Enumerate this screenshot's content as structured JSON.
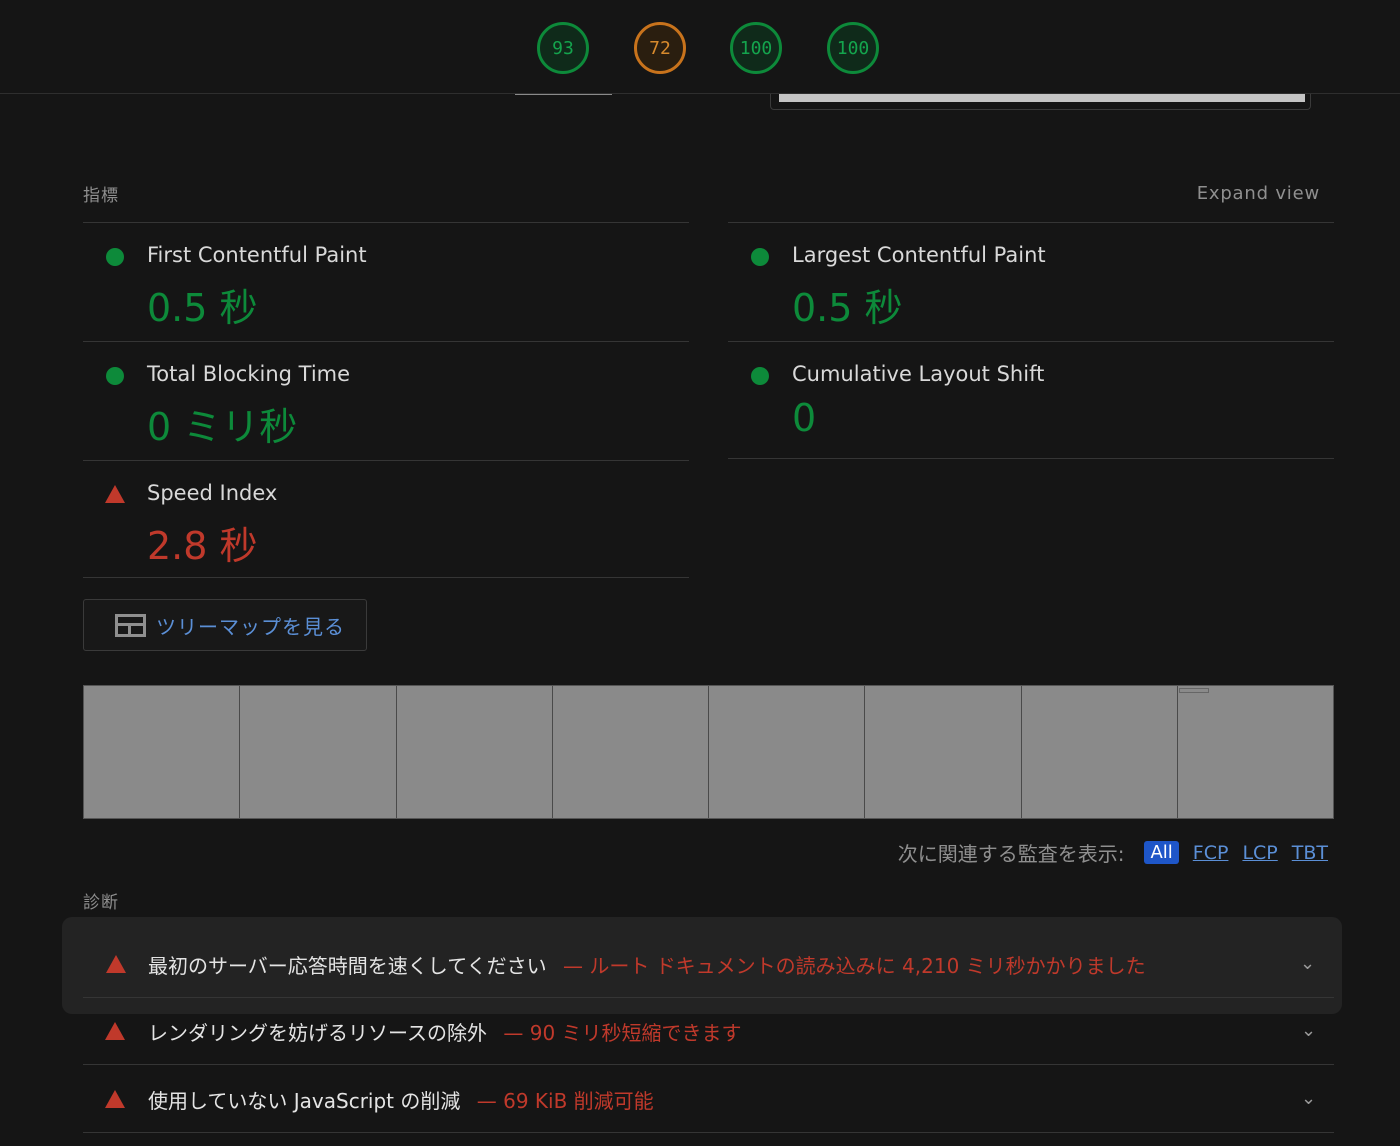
{
  "scores": [
    {
      "value": "93",
      "status": "pass"
    },
    {
      "value": "72",
      "status": "average"
    },
    {
      "value": "100",
      "status": "pass"
    },
    {
      "value": "100",
      "status": "pass"
    }
  ],
  "metrics_section": {
    "label": "指標",
    "expand_label": "Expand view",
    "items": [
      {
        "name": "First Contentful Paint",
        "value": "0.5 秒",
        "status": "good"
      },
      {
        "name": "Largest Contentful Paint",
        "value": "0.5 秒",
        "status": "good"
      },
      {
        "name": "Total Blocking Time",
        "value": "0 ミリ秒",
        "status": "good"
      },
      {
        "name": "Cumulative Layout Shift",
        "value": "0",
        "status": "good"
      },
      {
        "name": "Speed Index",
        "value": "2.8 秒",
        "status": "poor"
      }
    ]
  },
  "treemap_button": {
    "label": "ツリーマップを見る",
    "icon": "treemap-icon"
  },
  "filmstrip": {
    "frame_count": 8
  },
  "audit_filter": {
    "label": "次に関連する監査を表示:",
    "options": [
      "All",
      "FCP",
      "LCP",
      "TBT"
    ],
    "selected": "All"
  },
  "diagnostics": {
    "label": "診断",
    "items": [
      {
        "title": "最初のサーバー応答時間を速くしてください",
        "desc": "— ルート ドキュメントの読み込みに 4,210 ミリ秒かかりました",
        "highlighted": true
      },
      {
        "title": "レンダリングを妨げるリソースの除外",
        "desc": "— 90 ミリ秒短縮できます",
        "highlighted": false
      },
      {
        "title": "使用していない JavaScript の削減",
        "desc": "— 69 KiB 削減可能",
        "highlighted": false
      }
    ]
  },
  "colors": {
    "pass": "#0d8a3a",
    "average": "#c8731c",
    "fail": "#c0392b",
    "link": "#5b8fd6",
    "accent_chip": "#1e56c8"
  }
}
